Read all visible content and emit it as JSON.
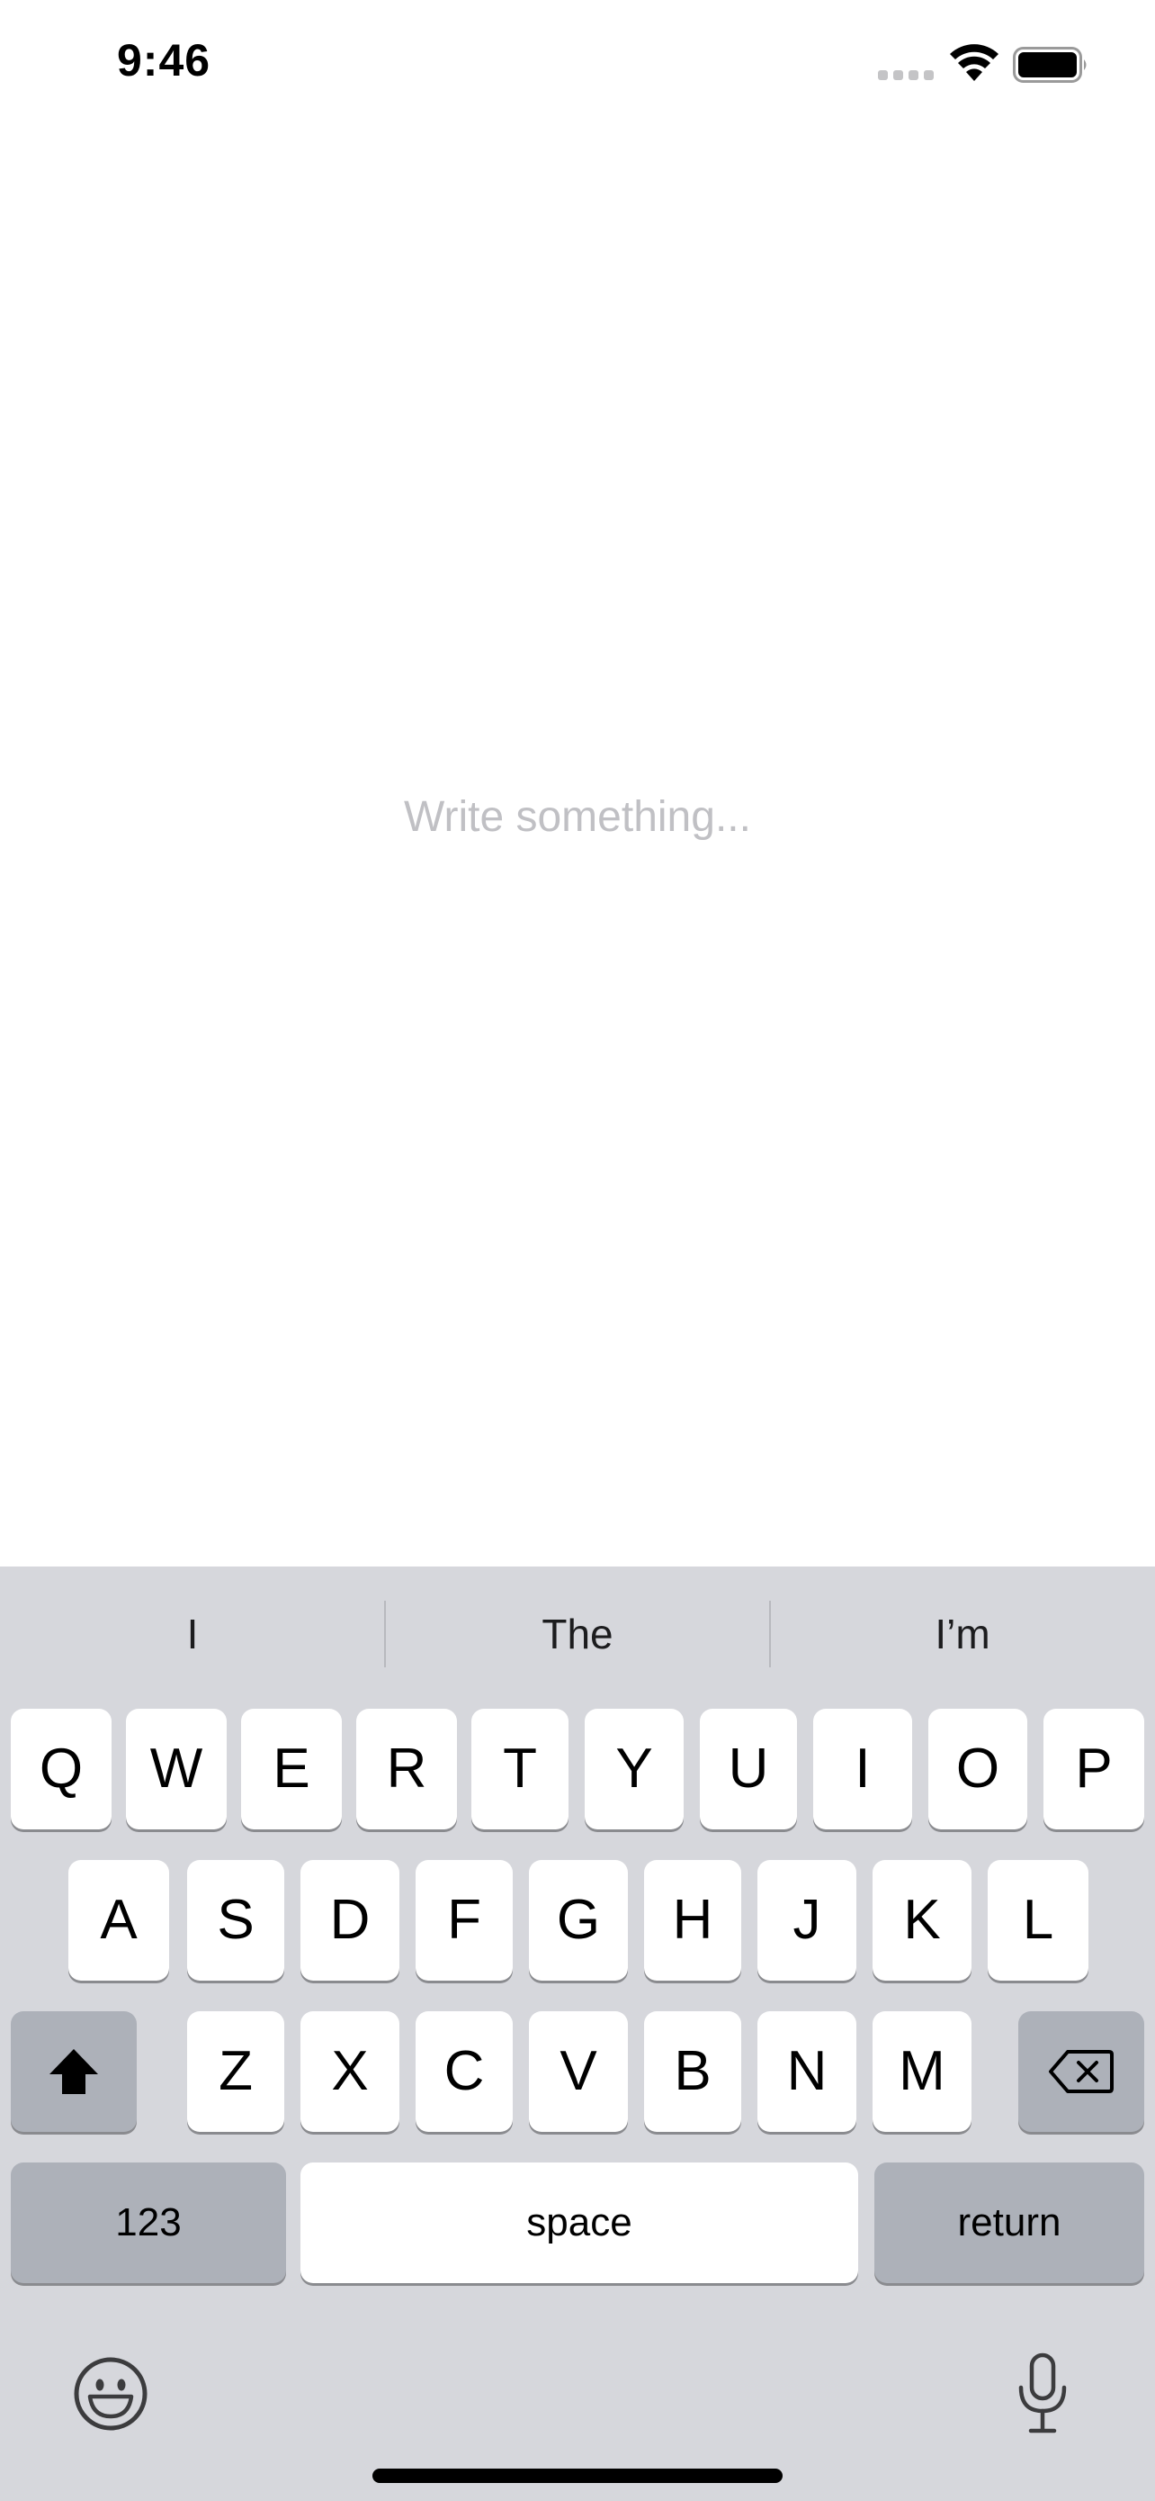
{
  "status_bar": {
    "time": "9:46"
  },
  "editor": {
    "placeholder": "Write something..."
  },
  "keyboard": {
    "suggestions": [
      "I",
      "The",
      "I’m"
    ],
    "rows": [
      [
        "Q",
        "W",
        "E",
        "R",
        "T",
        "Y",
        "U",
        "I",
        "O",
        "P"
      ],
      [
        "A",
        "S",
        "D",
        "F",
        "G",
        "H",
        "J",
        "K",
        "L"
      ],
      [
        "Z",
        "X",
        "C",
        "V",
        "B",
        "N",
        "M"
      ]
    ],
    "numbers_label": "123",
    "space_label": "space",
    "return_label": "return",
    "icons": {
      "shift": "shift-icon",
      "delete": "delete-icon",
      "emoji": "emoji-icon",
      "dictation": "microphone-icon"
    }
  }
}
